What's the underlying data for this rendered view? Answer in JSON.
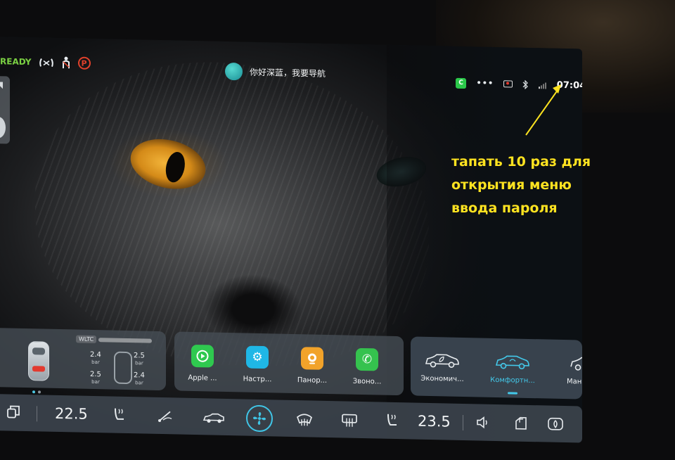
{
  "status": {
    "ready": "READY",
    "assistant_prompt": "你好深蓝，我要导航",
    "clock": "07:04",
    "carplay_badge": "C"
  },
  "tire_card": {
    "wltc_label": "WLTC",
    "front_left": {
      "value": "2.4",
      "unit": "bar"
    },
    "front_right": {
      "value": "2.5",
      "unit": "bar"
    },
    "rear_left": {
      "value": "2.5",
      "unit": "bar"
    },
    "rear_right": {
      "value": "2.4",
      "unit": "bar"
    }
  },
  "apps": [
    {
      "label": "Apple ...",
      "icon": "carplay-icon",
      "color": "#2fc94f"
    },
    {
      "label": "Настр...",
      "icon": "settings-gear-icon",
      "color": "#1fb7e6"
    },
    {
      "label": "Панор...",
      "icon": "panorama-camera-icon",
      "color": "#f2a32a"
    },
    {
      "label": "Звоно...",
      "icon": "phone-icon",
      "color": "#35c24e"
    }
  ],
  "drive_modes": [
    {
      "label": "Экономич...",
      "icon": "eco-car-icon",
      "active": false
    },
    {
      "label": "Комфортн...",
      "icon": "comfort-car-icon",
      "active": true
    },
    {
      "label": "Ман",
      "icon": "manual-car-icon",
      "active": false
    }
  ],
  "climate": {
    "left_temp": "22.5",
    "right_temp": "23.5"
  },
  "annotation": {
    "line1": "тапать 10 раз для",
    "line2": "открытия меню",
    "line3": "ввода пароля"
  },
  "colors": {
    "accent": "#43c9ea",
    "ready_green": "#7bd043",
    "annotation_yellow": "#ffe320",
    "park_red": "#e0412b"
  }
}
